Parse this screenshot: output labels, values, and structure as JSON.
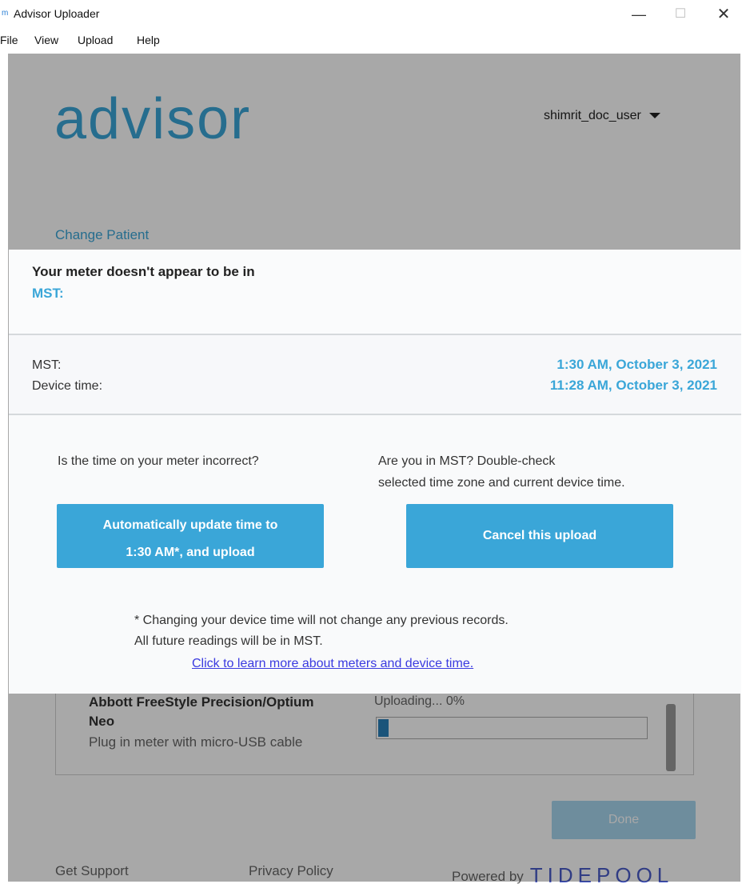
{
  "window": {
    "title": "Advisor Uploader",
    "icon_text": "m",
    "minimize": "—",
    "maximize": "☐",
    "close": "✕"
  },
  "menu": [
    "File",
    "View",
    "Upload",
    "Help"
  ],
  "header": {
    "logo": "advisor",
    "user": "shimrit_doc_user"
  },
  "change_patient": "Change Patient",
  "device": {
    "name_line1": "Abbott FreeStyle Precision/Optium",
    "name_line2": "Neo",
    "hint": "Plug in meter with micro-USB cable",
    "status": "Uploading... 0%",
    "progress": 0.04
  },
  "done_button": "Done",
  "footer": {
    "support": "Get Support",
    "privacy": "Privacy Policy",
    "powered": "Powered by",
    "brand": "TIDEPOOL"
  },
  "modal": {
    "warning": "Your meter doesn't appear to be in",
    "timezone": "MST:",
    "rows": [
      {
        "label": "MST:",
        "value": "1:30 AM, October 3, 2021"
      },
      {
        "label": "Device time:",
        "value": "11:28 AM, October 3, 2021"
      }
    ],
    "question_left": "Is the time on your meter incorrect?",
    "question_right_line1": "Are you in MST? Double-check",
    "question_right_line2": "selected time zone and current device time.",
    "auto_button_line1": "Automatically update time to",
    "auto_button_line2": "1:30 AM*, and upload",
    "cancel_button": "Cancel this upload",
    "note_line1": "* Changing your device time will not change any previous records.",
    "note_line2": "All future readings will be in MST.",
    "learn_more": "Click to learn more about meters and device time."
  }
}
